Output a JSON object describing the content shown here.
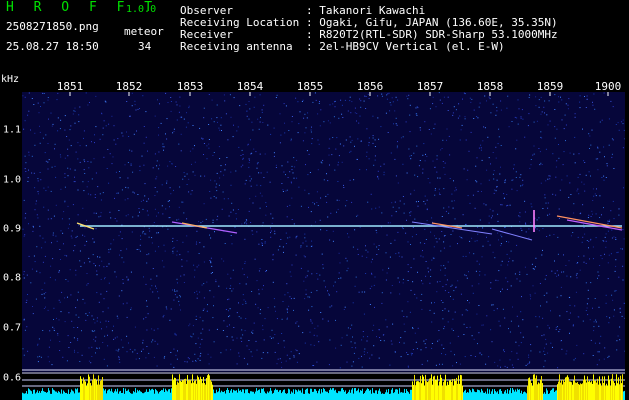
{
  "header": {
    "app_name": "H R O F F T",
    "version": "1.0.0",
    "filename": "2508271850.png",
    "meteor_label": "meteor",
    "datetime": "25.08.27 18:50",
    "meteor_count": "34",
    "info_rows": [
      {
        "label": "Observer",
        "value": ": Takanori Kawachi"
      },
      {
        "label": "Receiving Location",
        "value": ": Ogaki, Gifu, JAPAN (136.60E, 35.35N)"
      },
      {
        "label": "Receiver",
        "value": ": R820T2(RTL-SDR) SDR-Sharp 53.1000MHz"
      },
      {
        "label": "Receiving antenna",
        "value": ": 2el-HB9CV Vertical (el. E-W)"
      }
    ]
  },
  "axis": {
    "unit": "kHz",
    "time_labels": [
      "1851",
      "1852",
      "1853",
      "1854",
      "1855",
      "1856",
      "1857",
      "1858",
      "1859",
      "1900"
    ],
    "freq_labels": [
      "1.1",
      "1.0",
      "0.9",
      "0.8",
      "0.7",
      "0.6"
    ]
  },
  "colors": {
    "background": "#000000",
    "spectrogram_bg": "#06063a",
    "signal_line": "#9fe8ff",
    "meteor_trail": "#ffb060",
    "header_accent": "#00e000",
    "power_bar": "#00e5ff",
    "power_peak": "#ffff00"
  }
}
